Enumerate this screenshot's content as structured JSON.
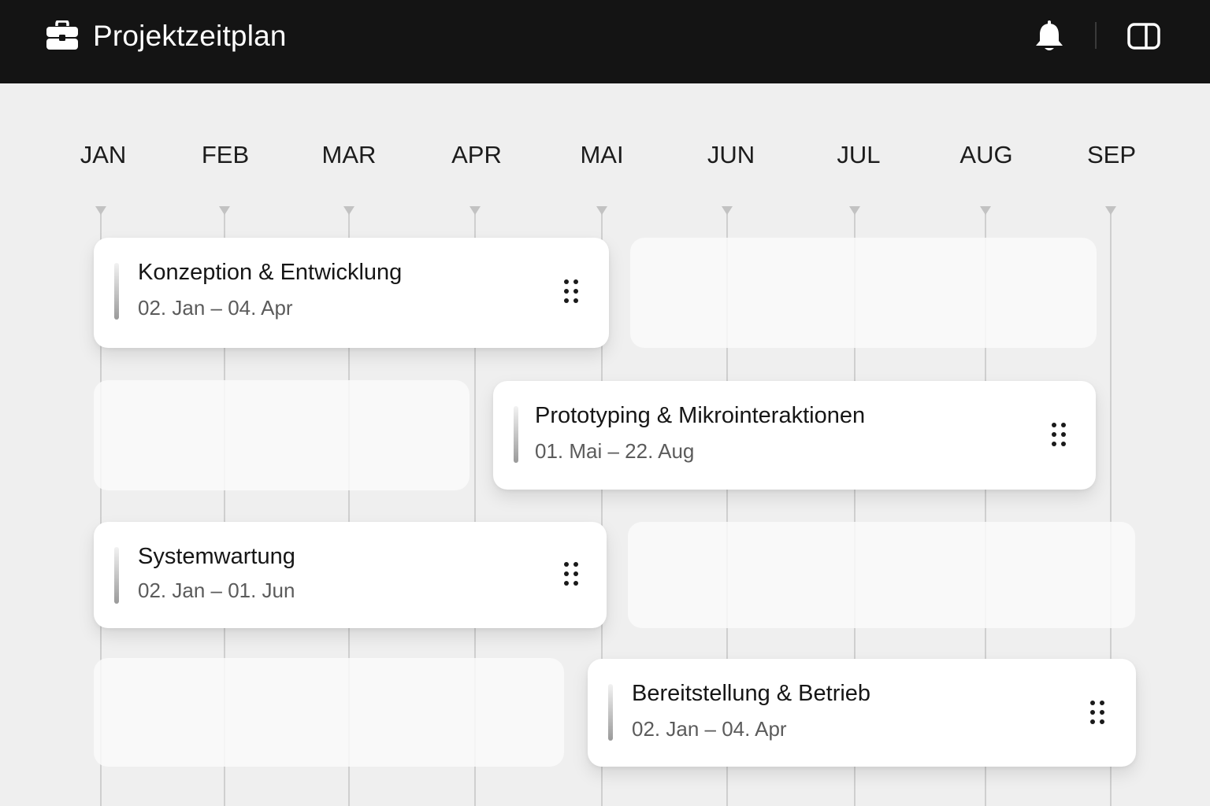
{
  "header": {
    "title": "Projektzeitplan",
    "app_icon": "briefcase-icon",
    "notification_icon": "bell-icon",
    "panel_icon": "sidebar-toggle-icon"
  },
  "timeline": {
    "months": [
      "JAN",
      "FEB",
      "MAR",
      "APR",
      "MAI",
      "JUN",
      "JUL",
      "AUG",
      "SEP"
    ]
  },
  "tasks": [
    {
      "title": "Konzeption & Entwicklung",
      "dates": "02. Jan – 04. Apr",
      "drag_icon": "drag-handle-icon"
    },
    {
      "title": "Prototyping & Mikrointeraktionen",
      "dates": "01. Mai – 22. Aug",
      "drag_icon": "drag-handle-icon"
    },
    {
      "title": "Systemwartung",
      "dates": "02. Jan – 01. Jun",
      "drag_icon": "drag-handle-icon"
    },
    {
      "title": "Bereitstellung & Betrieb",
      "dates": "02. Jan – 04. Apr",
      "drag_icon": "drag-handle-icon"
    }
  ],
  "colors": {
    "topbar": "#141414",
    "background": "#efefef",
    "card": "#ffffff",
    "text": "#161616",
    "muted": "#5b5b5b"
  }
}
